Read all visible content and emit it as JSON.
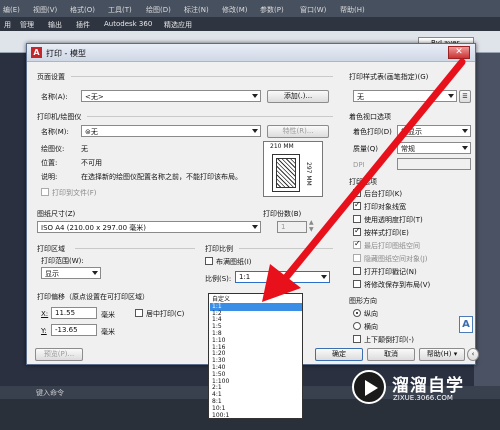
{
  "background": {
    "menu": [
      "编(E)",
      "视图(V)",
      "格式(O)",
      "工具(T)",
      "绘图(D)",
      "标注(N)",
      "修改(M)",
      "参数(P)",
      "窗口(W)",
      "帮助(H)"
    ],
    "ribbon_tabs": [
      "用",
      "管理",
      "输出",
      "插件",
      "Autodesk 360",
      "精选应用"
    ],
    "bylayer": "ByLayer",
    "command_prompt": "键入命令"
  },
  "dialog": {
    "title": "打印 - 模型",
    "page_setup": {
      "group": "页面设置",
      "name_label": "名称(A):",
      "name_value": "<无>",
      "add_button": "添加(.)..."
    },
    "printer": {
      "group": "打印机/绘图仪",
      "name_label": "名称(M):",
      "name_value": "⊜无",
      "properties_button": "特性(R)...",
      "plotter_label": "绘图仪:",
      "plotter_value": "无",
      "location_label": "位置:",
      "location_value": "不可用",
      "description_label": "说明:",
      "description_value": "在选择新的绘图仪配置名称之前，不能打印该布局。",
      "print_to_file": "打印到文件(F)"
    },
    "preview": {
      "width_dim": "210 MM",
      "height_dim": "297 MM"
    },
    "paper_size": {
      "group": "图纸尺寸(Z)",
      "value": "ISO A4 (210.00 x 297.00 毫米)"
    },
    "copies": {
      "label": "打印份数(B)",
      "value": "1"
    },
    "plot_area": {
      "group": "打印区域",
      "range_label": "打印范围(W):",
      "range_value": "显示"
    },
    "plot_offset": {
      "group": "打印偏移（原点设置在可打印区域）",
      "x_label": "X:",
      "x_value": "11.55",
      "x_unit": "毫米",
      "y_label": "Y:",
      "y_value": "-13.65",
      "y_unit": "毫米",
      "center_plot": "居中打印(C)"
    },
    "plot_scale": {
      "group": "打印比例",
      "fit_paper": "布满图纸(I)",
      "scale_label": "比例(S):",
      "scale_value": "1:1"
    },
    "scale_options": [
      "自定义",
      "1:1",
      "1:2",
      "1:4",
      "1:5",
      "1:8",
      "1:10",
      "1:16",
      "1:20",
      "1:30",
      "1:40",
      "1:50",
      "1:100",
      "2:1",
      "4:1",
      "8:1",
      "10:1",
      "100:1"
    ],
    "scale_highlighted": "1:1",
    "plot_style": {
      "group": "打印样式表(画笔指定)(G)",
      "value": "无"
    },
    "shaded_viewport": {
      "group": "着色视口选项",
      "shade_label": "着色打印(D)",
      "shade_value": "按显示",
      "quality_label": "质量(Q)",
      "quality_value": "常规",
      "dpi_label": "DPI"
    },
    "plot_options": {
      "group": "打印选项",
      "items": [
        {
          "label": "后台打印(K)",
          "checked": false,
          "disabled": false
        },
        {
          "label": "打印对象线宽",
          "checked": true,
          "disabled": false
        },
        {
          "label": "使用透明度打印(T)",
          "checked": false,
          "disabled": false
        },
        {
          "label": "按样式打印(E)",
          "checked": true,
          "disabled": false
        },
        {
          "label": "最后打印图纸空间",
          "checked": true,
          "disabled": true
        },
        {
          "label": "隐藏图纸空间对象(J)",
          "checked": false,
          "disabled": true
        },
        {
          "label": "打开打印戳记(N)",
          "checked": false,
          "disabled": false
        },
        {
          "label": "将修改保存到布局(V)",
          "checked": false,
          "disabled": false
        }
      ]
    },
    "orientation": {
      "group": "图形方向",
      "portrait": "纵向",
      "landscape": "横向",
      "upside_down": "上下颠倒打印(-)",
      "icon_letter": "A"
    },
    "buttons": {
      "preview": "预览(P)...",
      "ok": "确定",
      "cancel": "取消",
      "help": "帮助(H)"
    }
  },
  "watermark": {
    "title": "溜溜自学",
    "url": "ZIXUE.3066.COM"
  }
}
